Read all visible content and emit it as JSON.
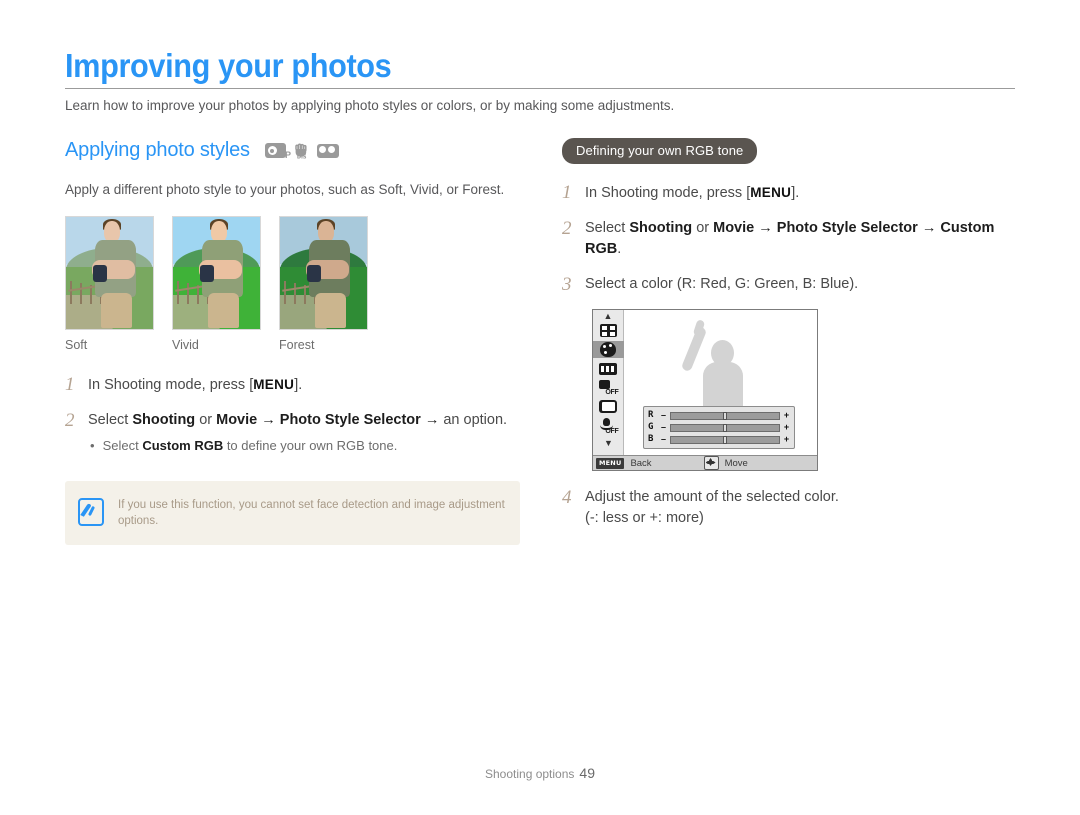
{
  "header": {
    "title": "Improving your photos",
    "intro": "Learn how to improve your photos by applying photo styles or colors, or by making some adjustments."
  },
  "left_column": {
    "section_heading": "Applying photo styles",
    "mode_icons": [
      {
        "name": "program-mode-icon",
        "label": "P"
      },
      {
        "name": "dis-mode-icon",
        "label": "DIS"
      },
      {
        "name": "movie-mode-icon",
        "label": ""
      }
    ],
    "description": "Apply a different photo style to your photos, such as Soft, Vivid, or Forest.",
    "samples": [
      {
        "label": "Soft",
        "sky": "#b9d7ea",
        "hill": "#8fae8d",
        "grass": "#79a860",
        "skin": "#e8c6ab",
        "vest": "#93a184"
      },
      {
        "label": "Vivid",
        "sky": "#9fd6f2",
        "hill": "#4f9a58",
        "grass": "#3fb238",
        "skin": "#f0c9a6",
        "vest": "#8fa077"
      },
      {
        "label": "Forest",
        "sky": "#a8c9db",
        "hill": "#2e7a3e",
        "grass": "#2f8c35",
        "skin": "#dab495",
        "vest": "#6d7d5e"
      }
    ],
    "steps": [
      {
        "num": "1",
        "prefix": "In Shooting mode, press [",
        "kbd": "MENU",
        "suffix": "]."
      },
      {
        "num": "2",
        "parts": [
          {
            "t": "Select ",
            "b": false
          },
          {
            "t": "Shooting",
            "b": true
          },
          {
            "t": " or ",
            "b": false
          },
          {
            "t": "Movie",
            "b": true
          },
          {
            "t": " → ",
            "b": true
          },
          {
            "t": "Photo Style Selector",
            "b": true
          },
          {
            "t": " →",
            "b": true
          },
          {
            "t": " an option.",
            "b": false
          }
        ],
        "substep": {
          "bullet": "•",
          "pre": "Select ",
          "bold": "Custom RGB",
          "post": " to define your own RGB tone."
        }
      }
    ],
    "note": {
      "icon": "note-pen-icon",
      "text": "If you use this function, you cannot set face detection and image adjustment options."
    }
  },
  "right_column": {
    "pill_label": "Defining your own RGB tone",
    "steps": [
      {
        "num": "1",
        "prefix": "In Shooting mode, press [",
        "kbd": "MENU",
        "suffix": "]."
      },
      {
        "num": "2",
        "parts": [
          {
            "t": "Select ",
            "b": false
          },
          {
            "t": "Shooting",
            "b": true
          },
          {
            "t": " or ",
            "b": false
          },
          {
            "t": "Movie",
            "b": true
          },
          {
            "t": " → ",
            "b": true
          },
          {
            "t": "Photo Style Selector",
            "b": true
          },
          {
            "t": " →",
            "b": true
          },
          {
            "t": " ",
            "b": false
          },
          {
            "t": "Custom RGB",
            "b": true
          },
          {
            "t": ".",
            "b": false
          }
        ]
      },
      {
        "num": "3",
        "plain": "Select a color (R: Red, G: Green, B: Blue)."
      },
      {
        "num": "4",
        "plain": "Adjust the amount of the selected color.",
        "line2": "(-: less or +: more)"
      }
    ],
    "lcd": {
      "side_icons": [
        {
          "name": "chevron-up-icon",
          "glyph": "▲"
        },
        {
          "name": "grid-icon",
          "selected": false
        },
        {
          "name": "palette-icon",
          "selected": true
        },
        {
          "name": "film-strip-icon",
          "selected": false
        },
        {
          "name": "face-detect-off-icon",
          "selected": false,
          "tag": "OFF"
        },
        {
          "name": "screen-icon",
          "selected": false
        },
        {
          "name": "voice-memo-off-icon",
          "selected": false,
          "tag": "OFF"
        },
        {
          "name": "chevron-down-icon",
          "glyph": "▼"
        }
      ],
      "sliders": [
        {
          "label": "R",
          "minus": "–",
          "plus": "+",
          "value": 50
        },
        {
          "label": "G",
          "minus": "–",
          "plus": "+",
          "value": 50
        },
        {
          "label": "B",
          "minus": "–",
          "plus": "+",
          "value": 50
        }
      ],
      "bottom_bar": {
        "menu_badge": "MENU",
        "back_label": "Back",
        "dpad_icon": "dpad-icon",
        "move_label": "Move"
      }
    }
  },
  "footer": {
    "section": "Shooting options",
    "page": "49"
  }
}
